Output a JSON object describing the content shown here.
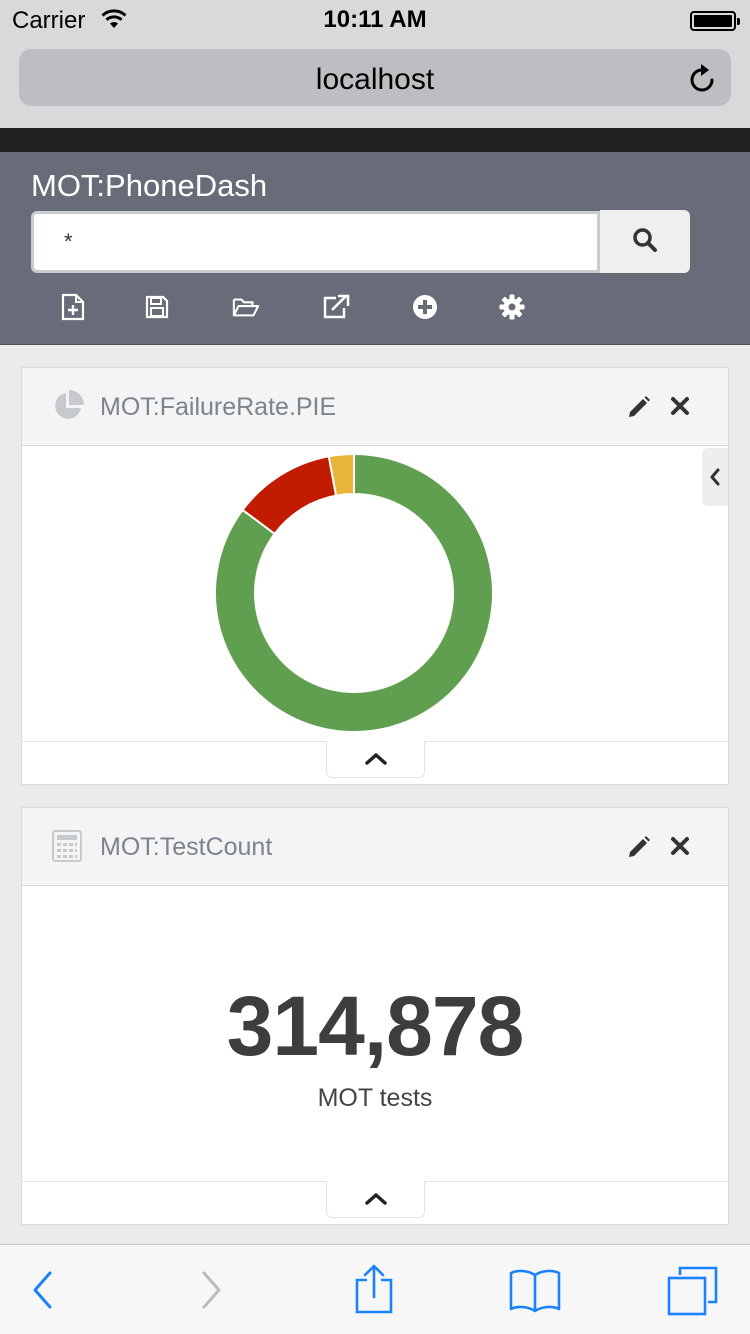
{
  "status_bar": {
    "carrier": "Carrier",
    "time": "10:11 AM"
  },
  "browser": {
    "url": "localhost"
  },
  "app": {
    "title": "MOT:PhoneDash",
    "search": {
      "value": "*"
    },
    "toolbar": [
      "new-dashboard-icon",
      "save-icon",
      "open-folder-icon",
      "external-link-icon",
      "add-widget-icon",
      "settings-gear-icon"
    ]
  },
  "widgets": {
    "failure_rate": {
      "title": "MOT:FailureRate.PIE",
      "icon": "pie-chart-icon"
    },
    "test_count": {
      "title": "MOT:TestCount",
      "icon": "calculator-icon",
      "value": "314,878",
      "label": "MOT tests"
    }
  },
  "colors": {
    "header_bg": "#676c78",
    "pass": "#5f9f4f",
    "fail": "#c21c00",
    "warn": "#e8b43a",
    "ios_blue": "#1a82fb"
  },
  "chart_data": {
    "type": "pie",
    "donut": true,
    "slices": [
      {
        "value": 85.2,
        "color": "#5f9f4f"
      },
      {
        "value": 11.9,
        "color": "#c21c00"
      },
      {
        "value": 2.9,
        "color": "#e8b43a"
      }
    ]
  }
}
